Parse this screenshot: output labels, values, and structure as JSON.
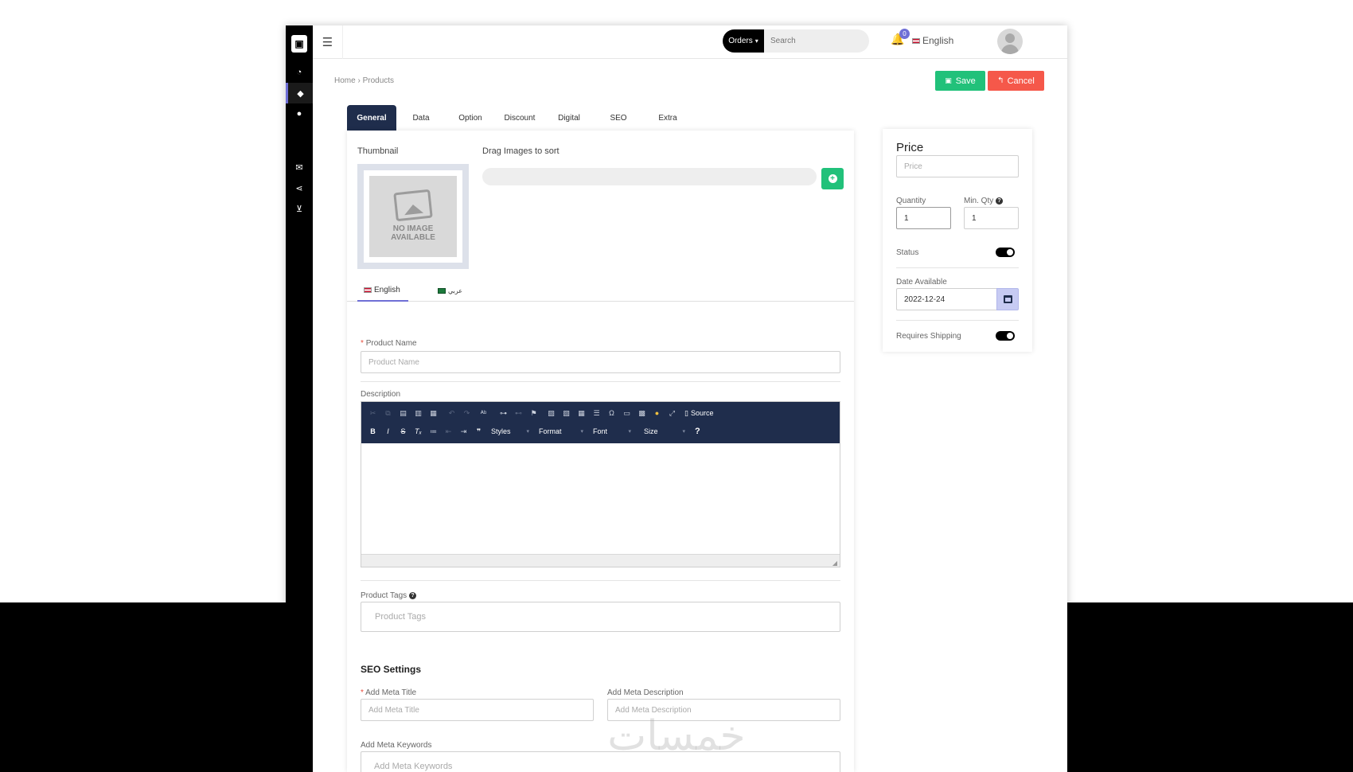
{
  "topbar": {
    "orders_label": "Orders",
    "search_placeholder": "Search",
    "notification_count": "0",
    "language": "English"
  },
  "breadcrumb": {
    "home": "Home",
    "separator": "›",
    "current": "Products"
  },
  "actions": {
    "save": "Save",
    "cancel": "Cancel"
  },
  "tabs": [
    "General",
    "Data",
    "Option",
    "Discount",
    "Digital",
    "SEO",
    "Extra"
  ],
  "active_tab": "General",
  "general": {
    "thumbnail_label": "Thumbnail",
    "no_image_line1": "NO IMAGE",
    "no_image_line2": "AVAILABLE",
    "drag_label": "Drag Images to sort",
    "language_tabs": [
      "English",
      "عربي"
    ],
    "product_name_label": "Product Name",
    "product_name_placeholder": "Product Name",
    "description_label": "Description",
    "product_tags_label": "Product Tags",
    "product_tags_placeholder": "Product Tags",
    "seo_title": "SEO Settings",
    "meta_title_label": "Add Meta Title",
    "meta_title_placeholder": "Add Meta Title",
    "meta_description_label": "Add Meta Description",
    "meta_description_placeholder": "Add Meta Description",
    "meta_keywords_label": "Add Meta Keywords",
    "meta_keywords_placeholder": "Add Meta Keywords"
  },
  "editor_toolbar": {
    "source": "Source",
    "styles": "Styles",
    "format": "Format",
    "font": "Font",
    "size": "Size",
    "help": "?"
  },
  "price_panel": {
    "title": "Price",
    "price_placeholder": "Price",
    "quantity_label": "Quantity",
    "quantity_value": "1",
    "min_qty_label": "Min. Qty",
    "min_qty_value": "1",
    "status_label": "Status",
    "status_on": true,
    "date_label": "Date Available",
    "date_value": "2022-12-24",
    "shipping_label": "Requires Shipping",
    "shipping_on": true
  },
  "watermark": "خمسات",
  "colors": {
    "sidebar": "#000000",
    "tab_active": "#1f2d4c",
    "save": "#21c17a",
    "cancel": "#f5584a",
    "accent": "#6f6fd6"
  }
}
